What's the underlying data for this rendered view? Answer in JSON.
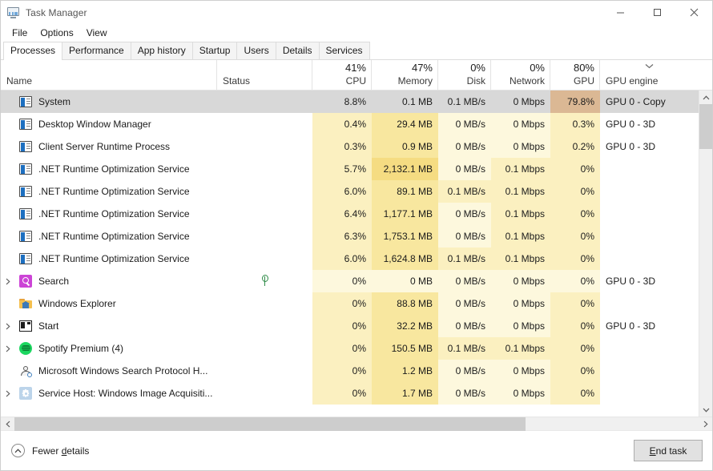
{
  "window": {
    "title": "Task Manager",
    "icon": "task-manager-icon",
    "controls": {
      "minimize": "—",
      "maximize": "□",
      "close": "✕"
    }
  },
  "menu": {
    "items": [
      "File",
      "Options",
      "View"
    ]
  },
  "tabs": {
    "active": "Processes",
    "items": [
      "Processes",
      "Performance",
      "App history",
      "Startup",
      "Users",
      "Details",
      "Services"
    ]
  },
  "columns": [
    {
      "key": "name",
      "label": "Name",
      "pct": "",
      "sorted": false
    },
    {
      "key": "status",
      "label": "Status",
      "pct": "",
      "sorted": false
    },
    {
      "key": "cpu",
      "label": "CPU",
      "pct": "41%",
      "sorted": false
    },
    {
      "key": "memory",
      "label": "Memory",
      "pct": "47%",
      "sorted": false
    },
    {
      "key": "disk",
      "label": "Disk",
      "pct": "0%",
      "sorted": false
    },
    {
      "key": "network",
      "label": "Network",
      "pct": "0%",
      "sorted": false
    },
    {
      "key": "gpu",
      "label": "GPU",
      "pct": "80%",
      "sorted": true,
      "sort_direction": "descending"
    },
    {
      "key": "gpuengine",
      "label": "GPU engine",
      "pct": "",
      "sorted": false
    }
  ],
  "rows": [
    {
      "name": "System",
      "icon": "windows-process-icon",
      "expandable": false,
      "selected": true,
      "status": "",
      "cpu": "8.8%",
      "memory": "0.1 MB",
      "disk": "0.1 MB/s",
      "network": "0 Mbps",
      "gpu": "79.8%",
      "gpuengine": "GPU 0 - Copy",
      "heat": {
        "cpu": 2,
        "memory": 1,
        "disk": 2,
        "network": 0,
        "gpu": 5
      }
    },
    {
      "name": "Desktop Window Manager",
      "icon": "windows-process-icon",
      "expandable": false,
      "selected": false,
      "status": "",
      "cpu": "0.4%",
      "memory": "29.4 MB",
      "disk": "0 MB/s",
      "network": "0 Mbps",
      "gpu": "0.3%",
      "gpuengine": "GPU 0 - 3D",
      "heat": {
        "cpu": 2,
        "memory": 3,
        "disk": 1,
        "network": 1,
        "gpu": 2
      }
    },
    {
      "name": "Client Server Runtime Process",
      "icon": "windows-process-icon",
      "expandable": false,
      "selected": false,
      "status": "",
      "cpu": "0.3%",
      "memory": "0.9 MB",
      "disk": "0 MB/s",
      "network": "0 Mbps",
      "gpu": "0.2%",
      "gpuengine": "GPU 0 - 3D",
      "heat": {
        "cpu": 2,
        "memory": 3,
        "disk": 1,
        "network": 1,
        "gpu": 2
      }
    },
    {
      "name": ".NET Runtime Optimization Service",
      "icon": "windows-process-icon",
      "expandable": false,
      "selected": false,
      "status": "",
      "cpu": "5.7%",
      "memory": "2,132.1 MB",
      "disk": "0 MB/s",
      "network": "0.1 Mbps",
      "gpu": "0%",
      "gpuengine": "",
      "heat": {
        "cpu": 2,
        "memory": 4,
        "disk": 1,
        "network": 2,
        "gpu": 2
      }
    },
    {
      "name": ".NET Runtime Optimization Service",
      "icon": "windows-process-icon",
      "expandable": false,
      "selected": false,
      "status": "",
      "cpu": "6.0%",
      "memory": "89.1 MB",
      "disk": "0.1 MB/s",
      "network": "0.1 Mbps",
      "gpu": "0%",
      "gpuengine": "",
      "heat": {
        "cpu": 2,
        "memory": 3,
        "disk": 2,
        "network": 2,
        "gpu": 2
      }
    },
    {
      "name": ".NET Runtime Optimization Service",
      "icon": "windows-process-icon",
      "expandable": false,
      "selected": false,
      "status": "",
      "cpu": "6.4%",
      "memory": "1,177.1 MB",
      "disk": "0 MB/s",
      "network": "0.1 Mbps",
      "gpu": "0%",
      "gpuengine": "",
      "heat": {
        "cpu": 2,
        "memory": 3,
        "disk": 1,
        "network": 2,
        "gpu": 2
      }
    },
    {
      "name": ".NET Runtime Optimization Service",
      "icon": "windows-process-icon",
      "expandable": false,
      "selected": false,
      "status": "",
      "cpu": "6.3%",
      "memory": "1,753.1 MB",
      "disk": "0 MB/s",
      "network": "0.1 Mbps",
      "gpu": "0%",
      "gpuengine": "",
      "heat": {
        "cpu": 2,
        "memory": 3,
        "disk": 1,
        "network": 2,
        "gpu": 2
      }
    },
    {
      "name": ".NET Runtime Optimization Service",
      "icon": "windows-process-icon",
      "expandable": false,
      "selected": false,
      "status": "",
      "cpu": "6.0%",
      "memory": "1,624.8 MB",
      "disk": "0.1 MB/s",
      "network": "0.1 Mbps",
      "gpu": "0%",
      "gpuengine": "",
      "heat": {
        "cpu": 2,
        "memory": 3,
        "disk": 2,
        "network": 2,
        "gpu": 2
      }
    },
    {
      "name": "Search",
      "icon": "search-app-icon",
      "expandable": true,
      "selected": false,
      "status": "leaf-icon",
      "cpu": "0%",
      "memory": "0 MB",
      "disk": "0 MB/s",
      "network": "0 Mbps",
      "gpu": "0%",
      "gpuengine": "GPU 0 - 3D",
      "heat": {
        "cpu": 1,
        "memory": 1,
        "disk": 1,
        "network": 1,
        "gpu": 1
      }
    },
    {
      "name": "Windows Explorer",
      "icon": "folder-icon",
      "expandable": false,
      "selected": false,
      "status": "",
      "cpu": "0%",
      "memory": "88.8 MB",
      "disk": "0 MB/s",
      "network": "0 Mbps",
      "gpu": "0%",
      "gpuengine": "",
      "heat": {
        "cpu": 2,
        "memory": 3,
        "disk": 1,
        "network": 1,
        "gpu": 2
      }
    },
    {
      "name": "Start",
      "icon": "start-icon",
      "expandable": true,
      "selected": false,
      "status": "",
      "cpu": "0%",
      "memory": "32.2 MB",
      "disk": "0 MB/s",
      "network": "0 Mbps",
      "gpu": "0%",
      "gpuengine": "GPU 0 - 3D",
      "heat": {
        "cpu": 2,
        "memory": 3,
        "disk": 1,
        "network": 1,
        "gpu": 2
      }
    },
    {
      "name": "Spotify Premium (4)",
      "icon": "spotify-icon",
      "expandable": true,
      "selected": false,
      "status": "",
      "cpu": "0%",
      "memory": "150.5 MB",
      "disk": "0.1 MB/s",
      "network": "0.1 Mbps",
      "gpu": "0%",
      "gpuengine": "",
      "heat": {
        "cpu": 2,
        "memory": 3,
        "disk": 2,
        "network": 2,
        "gpu": 2
      }
    },
    {
      "name": "Microsoft Windows Search Protocol H...",
      "icon": "person-search-icon",
      "expandable": false,
      "selected": false,
      "status": "",
      "cpu": "0%",
      "memory": "1.2 MB",
      "disk": "0 MB/s",
      "network": "0 Mbps",
      "gpu": "0%",
      "gpuengine": "",
      "heat": {
        "cpu": 2,
        "memory": 3,
        "disk": 1,
        "network": 1,
        "gpu": 2
      }
    },
    {
      "name": "Service Host: Windows Image Acquisiti...",
      "icon": "gear-icon",
      "expandable": true,
      "selected": false,
      "status": "",
      "cpu": "0%",
      "memory": "1.7 MB",
      "disk": "0 MB/s",
      "network": "0 Mbps",
      "gpu": "0%",
      "gpuengine": "",
      "heat": {
        "cpu": 2,
        "memory": 3,
        "disk": 1,
        "network": 1,
        "gpu": 2
      }
    }
  ],
  "heat_colors": [
    "#ffffff",
    "#fdf8dd",
    "#fbf0c0",
    "#f8e79f",
    "#f5dc82",
    "#dbb894"
  ],
  "footer": {
    "fewer_details": "Fewer details",
    "fewer_details_prefix": "Fewer ",
    "fewer_details_accel": "d",
    "fewer_details_suffix": "etails",
    "end_task": "End task",
    "end_task_accel": "E",
    "end_task_rest": "nd task"
  },
  "scrollbars": {
    "vertical_up": "ⱏ",
    "vertical_down": "ⱟ",
    "horizontal_left": "‹",
    "horizontal_right": "›"
  }
}
